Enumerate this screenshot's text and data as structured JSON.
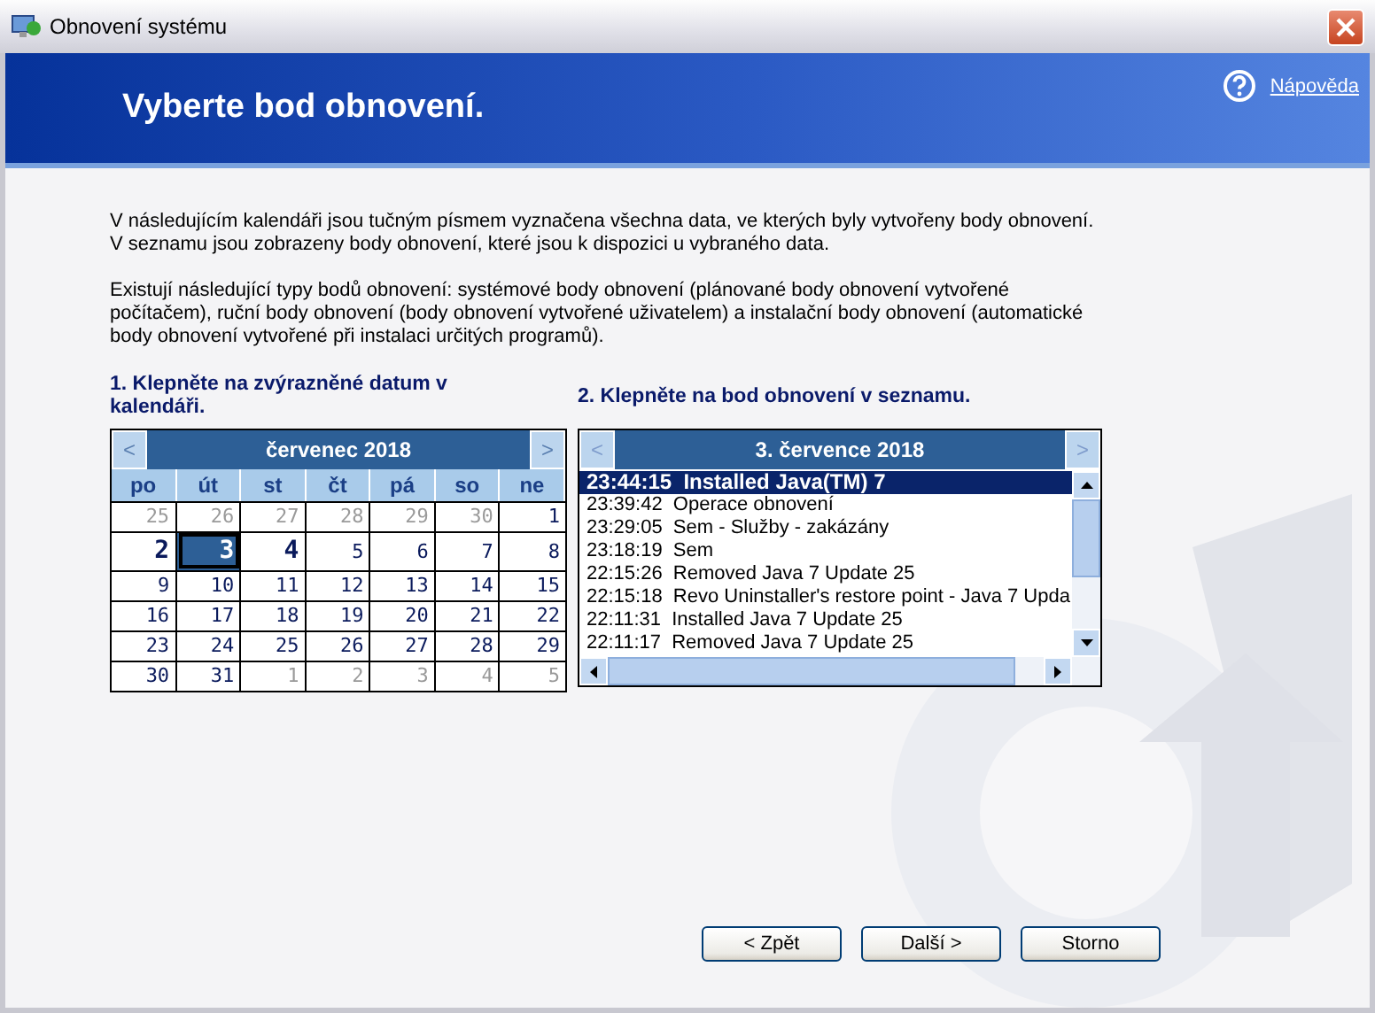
{
  "window": {
    "title": "Obnovení systému"
  },
  "header": {
    "title": "Vyberte bod obnovení.",
    "help_link": "Nápověda"
  },
  "intro": [
    "V následujícím kalendáři jsou tučným písmem vyznačena všechna data, ve kterých byly vytvořeny body obnovení. V seznamu jsou zobrazeny body obnovení, které jsou k dispozici u vybraného data.",
    "Existují následující typy bodů obnovení: systémové body obnovení (plánované body obnovení vytvořené počítačem), ruční body obnovení (body obnovení vytvořené uživatelem) a instalační body obnovení (automatické body obnovení vytvořené při instalaci určitých programů)."
  ],
  "calendar": {
    "heading": "1. Klepněte na zvýrazněné datum v kalendáři.",
    "month": "červenec 2018",
    "prev": {
      "label": "<",
      "disabled": false
    },
    "next": {
      "label": ">",
      "disabled": false
    },
    "weekdays": [
      "po",
      "út",
      "st",
      "čt",
      "pá",
      "so",
      "ne"
    ],
    "weeks": [
      [
        {
          "day": "25",
          "outside": true,
          "bold": false,
          "selected": false
        },
        {
          "day": "26",
          "outside": true,
          "bold": false,
          "selected": false
        },
        {
          "day": "27",
          "outside": true,
          "bold": false,
          "selected": false
        },
        {
          "day": "28",
          "outside": true,
          "bold": false,
          "selected": false
        },
        {
          "day": "29",
          "outside": true,
          "bold": false,
          "selected": false
        },
        {
          "day": "30",
          "outside": true,
          "bold": false,
          "selected": false
        },
        {
          "day": "1",
          "outside": false,
          "bold": false,
          "selected": false
        }
      ],
      [
        {
          "day": "2",
          "outside": false,
          "bold": true,
          "selected": false
        },
        {
          "day": "3",
          "outside": false,
          "bold": true,
          "selected": true
        },
        {
          "day": "4",
          "outside": false,
          "bold": true,
          "selected": false
        },
        {
          "day": "5",
          "outside": false,
          "bold": false,
          "selected": false
        },
        {
          "day": "6",
          "outside": false,
          "bold": false,
          "selected": false
        },
        {
          "day": "7",
          "outside": false,
          "bold": false,
          "selected": false
        },
        {
          "day": "8",
          "outside": false,
          "bold": false,
          "selected": false
        }
      ],
      [
        {
          "day": "9",
          "outside": false,
          "bold": false,
          "selected": false
        },
        {
          "day": "10",
          "outside": false,
          "bold": false,
          "selected": false
        },
        {
          "day": "11",
          "outside": false,
          "bold": false,
          "selected": false
        },
        {
          "day": "12",
          "outside": false,
          "bold": false,
          "selected": false
        },
        {
          "day": "13",
          "outside": false,
          "bold": false,
          "selected": false
        },
        {
          "day": "14",
          "outside": false,
          "bold": false,
          "selected": false
        },
        {
          "day": "15",
          "outside": false,
          "bold": false,
          "selected": false
        }
      ],
      [
        {
          "day": "16",
          "outside": false,
          "bold": false,
          "selected": false
        },
        {
          "day": "17",
          "outside": false,
          "bold": false,
          "selected": false
        },
        {
          "day": "18",
          "outside": false,
          "bold": false,
          "selected": false
        },
        {
          "day": "19",
          "outside": false,
          "bold": false,
          "selected": false
        },
        {
          "day": "20",
          "outside": false,
          "bold": false,
          "selected": false
        },
        {
          "day": "21",
          "outside": false,
          "bold": false,
          "selected": false
        },
        {
          "day": "22",
          "outside": false,
          "bold": false,
          "selected": false
        }
      ],
      [
        {
          "day": "23",
          "outside": false,
          "bold": false,
          "selected": false
        },
        {
          "day": "24",
          "outside": false,
          "bold": false,
          "selected": false
        },
        {
          "day": "25",
          "outside": false,
          "bold": false,
          "selected": false
        },
        {
          "day": "26",
          "outside": false,
          "bold": false,
          "selected": false
        },
        {
          "day": "27",
          "outside": false,
          "bold": false,
          "selected": false
        },
        {
          "day": "28",
          "outside": false,
          "bold": false,
          "selected": false
        },
        {
          "day": "29",
          "outside": false,
          "bold": false,
          "selected": false
        }
      ],
      [
        {
          "day": "30",
          "outside": false,
          "bold": false,
          "selected": false
        },
        {
          "day": "31",
          "outside": false,
          "bold": false,
          "selected": false
        },
        {
          "day": "1",
          "outside": true,
          "bold": false,
          "selected": false
        },
        {
          "day": "2",
          "outside": true,
          "bold": false,
          "selected": false
        },
        {
          "day": "3",
          "outside": true,
          "bold": false,
          "selected": false
        },
        {
          "day": "4",
          "outside": true,
          "bold": false,
          "selected": false
        },
        {
          "day": "5",
          "outside": true,
          "bold": false,
          "selected": false
        }
      ]
    ]
  },
  "restore_points": {
    "heading": "2. Klepněte na bod obnovení v seznamu.",
    "date": "3. července 2018",
    "prev": {
      "label": "<",
      "disabled": true
    },
    "next": {
      "label": ">",
      "disabled": true
    },
    "items": [
      {
        "text": "23:44:15  Installed Java(TM) 7",
        "selected": true
      },
      {
        "text": "23:39:42  Operace obnovení",
        "selected": false
      },
      {
        "text": "23:29:05  Sem - Služby - zakázány",
        "selected": false
      },
      {
        "text": "23:18:19  Sem",
        "selected": false
      },
      {
        "text": "22:15:26  Removed Java 7 Update 25",
        "selected": false
      },
      {
        "text": "22:15:18  Revo Uninstaller's restore point - Java 7 Upda",
        "selected": false
      },
      {
        "text": "22:11:31  Installed Java 7 Update 25",
        "selected": false
      },
      {
        "text": "22:11:17  Removed Java 7 Update 25",
        "selected": false
      }
    ]
  },
  "buttons": [
    {
      "label": "< Zpět"
    },
    {
      "label": "Další >"
    },
    {
      "label": "Storno"
    }
  ]
}
